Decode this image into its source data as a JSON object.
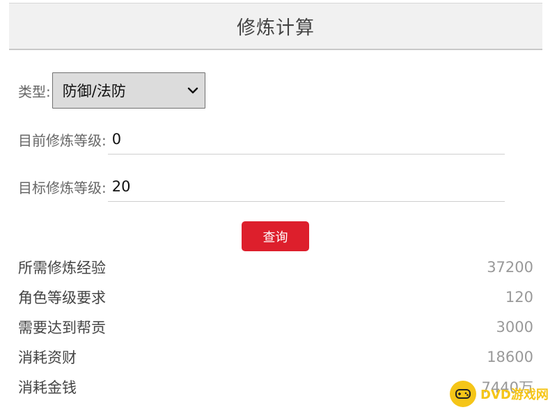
{
  "header": {
    "title": "修炼计算"
  },
  "form": {
    "type_label": "类型:",
    "type_selected": "防御/法防",
    "current_level_label": "目前修炼等级:",
    "current_level_value": "0",
    "target_level_label": "目标修炼等级:",
    "target_level_value": "20",
    "query_button": "查询"
  },
  "results": [
    {
      "label": "所需修炼经验",
      "value": "37200"
    },
    {
      "label": "角色等级要求",
      "value": "120"
    },
    {
      "label": "需要达到帮贡",
      "value": "3000"
    },
    {
      "label": "消耗资财",
      "value": "18600"
    },
    {
      "label": "消耗金钱",
      "value": "7440万"
    }
  ],
  "watermark": {
    "text": "DVD游戏网",
    "color": "#f5c518"
  },
  "colors": {
    "accent": "#dd1f2c",
    "header_bg": "#f1f1f1"
  },
  "icons": {
    "select_arrow": "chevron-down-icon",
    "watermark_logo": "gamepad-icon"
  }
}
